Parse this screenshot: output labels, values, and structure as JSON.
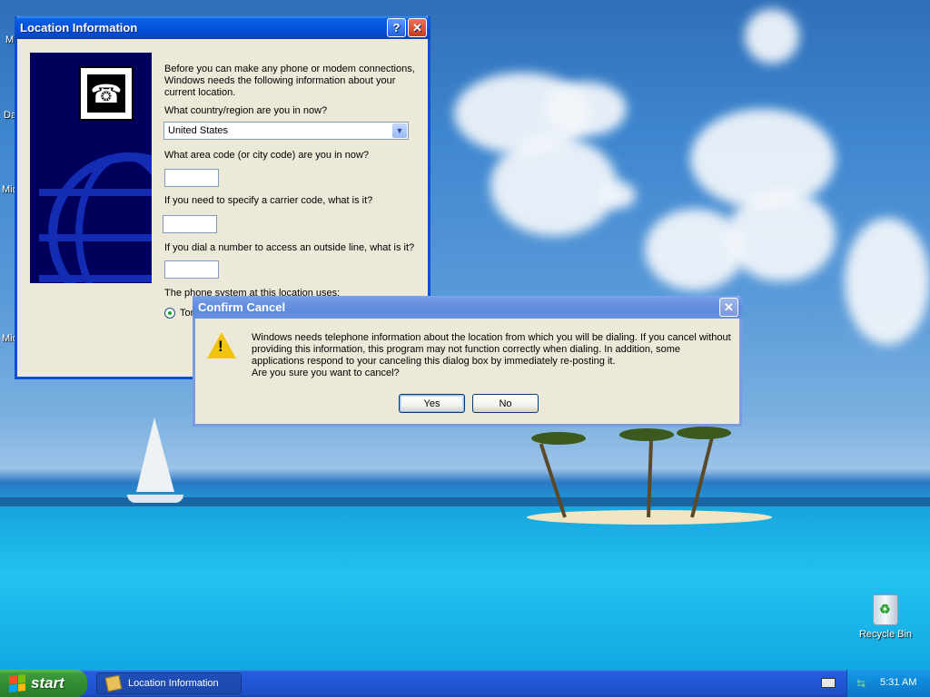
{
  "desktop": {
    "icon_labels": [
      "M",
      "Da",
      "Mic",
      "Mic"
    ],
    "recycle_bin_label": "Recycle Bin"
  },
  "location_dialog": {
    "title": "Location Information",
    "intro": "Before you can make any phone or modem connections, Windows needs the following information about your current location.",
    "country_question": "What country/region are you in now?",
    "country_value": "United States",
    "area_code_question": "What area code (or city code) are you in now?",
    "area_code_value": "",
    "carrier_question": "If you need to specify a carrier code, what is it?",
    "carrier_value": "",
    "outside_line_question": "If you dial a number to access an outside line, what is it?",
    "outside_line_value": "",
    "phone_system_label": "The phone system at this location uses:",
    "tone_option": "Tone dialing"
  },
  "confirm_dialog": {
    "title": "Confirm Cancel",
    "message": "Windows needs telephone information about the location from which you will be dialing. If you cancel without providing this information, this program may not function correctly when dialing. In addition, some applications respond to your canceling this dialog box by immediately re-posting it.",
    "question": "Are you sure you want to cancel?",
    "yes_label": "Yes",
    "no_label": "No"
  },
  "taskbar": {
    "start_label": "start",
    "task_label": "Location Information",
    "clock": "5:31 AM"
  },
  "colors": {
    "title_active": "#0553dd",
    "title_inactive": "#6e97e3",
    "dialog_face": "#ece9d8",
    "start_green": "#318a31"
  }
}
